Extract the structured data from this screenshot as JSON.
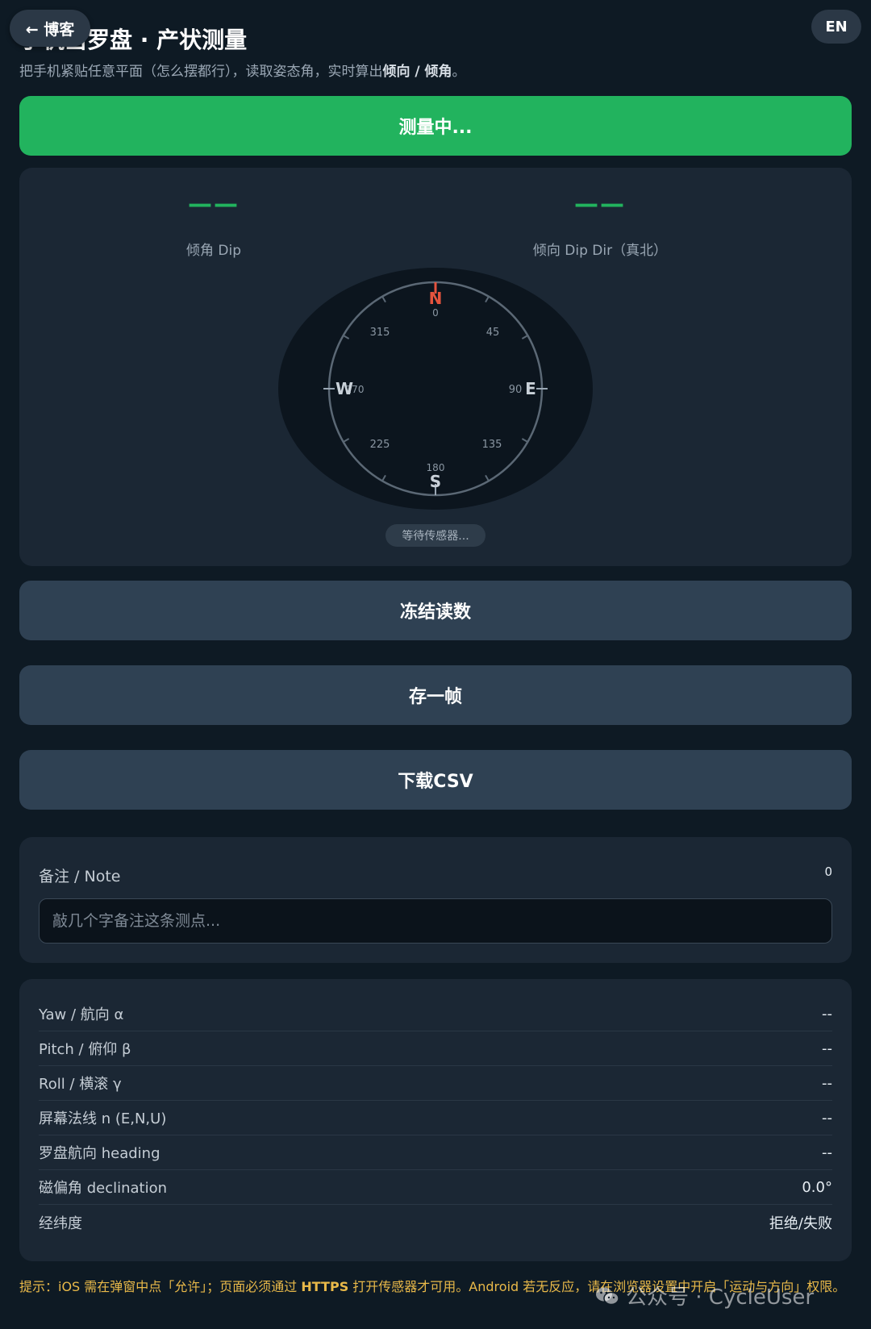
{
  "header": {
    "title": "手机当罗盘 · 产状测量",
    "subtitle_prefix": "把手机紧贴任意平面（怎么摆都行），读取姿态角，实时算出",
    "subtitle_bold": "倾向 / 倾角",
    "subtitle_suffix": "。",
    "back_label": "← 博客",
    "lang_label": "EN"
  },
  "primary_button": {
    "label": "测量中..."
  },
  "compass": {
    "dip_value": "——",
    "dip_label": "倾角 Dip",
    "dipdir_value": "——",
    "dipdir_label": "倾向 Dip Dir（真北）",
    "cardinals": {
      "n": "N",
      "e": "E",
      "s": "S",
      "w": "W"
    },
    "degree_labels": {
      "d0": "0",
      "d45": "45",
      "d90": "90",
      "d135": "135",
      "d180": "180",
      "d225": "225",
      "d270": "270",
      "d315": "315"
    },
    "status": "等待传感器..."
  },
  "actions": {
    "freeze": "冻结读数",
    "save_frame": "存一帧",
    "download": "下载CSV"
  },
  "note": {
    "label": "备注 / Note",
    "count": "0",
    "placeholder": "敲几个字备注这条测点..."
  },
  "readings": [
    {
      "key": "Yaw / 航向 α",
      "value": "--"
    },
    {
      "key": "Pitch / 俯仰 β",
      "value": "--"
    },
    {
      "key": "Roll / 横滚 γ",
      "value": "--"
    },
    {
      "key": "屏幕法线 n (E,N,U)",
      "value": "--"
    },
    {
      "key": "罗盘航向 heading",
      "value": "--"
    },
    {
      "key": "磁偏角 declination",
      "value": "0.0°"
    },
    {
      "key": "经纬度",
      "value": "拒绝/失败"
    }
  ],
  "tip": {
    "prefix": "提示：iOS 需在弹窗中点「允许」；页面必须通过 ",
    "bold": "HTTPS",
    "suffix": " 打开传感器才可用。Android 若无反应，请在浏览器设置中开启「运动与方向」权限。"
  },
  "watermark": {
    "icon": "wechat-icon",
    "text": "公众号 · CycleUser"
  },
  "colors": {
    "accent": "#22b35e",
    "tip": "#e9b949",
    "north": "#e5533d"
  }
}
